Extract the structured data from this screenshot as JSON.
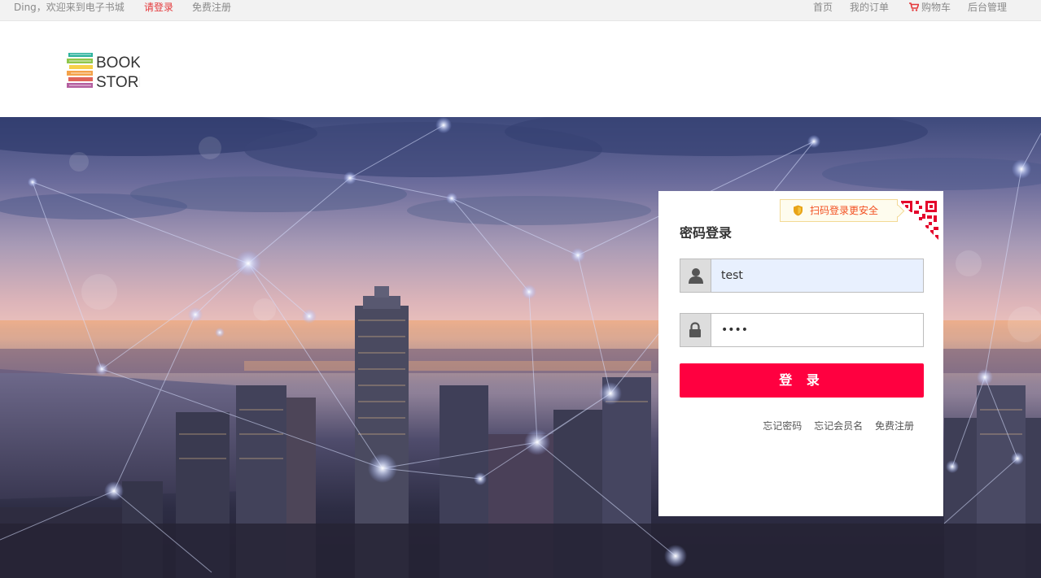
{
  "topbar": {
    "welcome": "Ding，欢迎来到电子书城",
    "login_link": "请登录",
    "register_link": "免费注册",
    "nav": [
      "首页",
      "我的订单",
      "购物车",
      "后台管理"
    ]
  },
  "logo": {
    "line1": "BOOK",
    "line2": "STORE"
  },
  "login_panel": {
    "qr_tip": "扫码登录更安全",
    "title": "密码登录",
    "username_value": "test",
    "password_value": "••••",
    "submit_label": "登 录",
    "links": [
      "忘记密码",
      "忘记会员名",
      "免费注册"
    ]
  },
  "colors": {
    "accent": "#ff0040",
    "login_link": "#e4393c",
    "qr_tip_text": "#f25022"
  },
  "icons": [
    "cart-icon",
    "shield-icon",
    "qr-code-icon",
    "user-icon",
    "lock-icon"
  ]
}
